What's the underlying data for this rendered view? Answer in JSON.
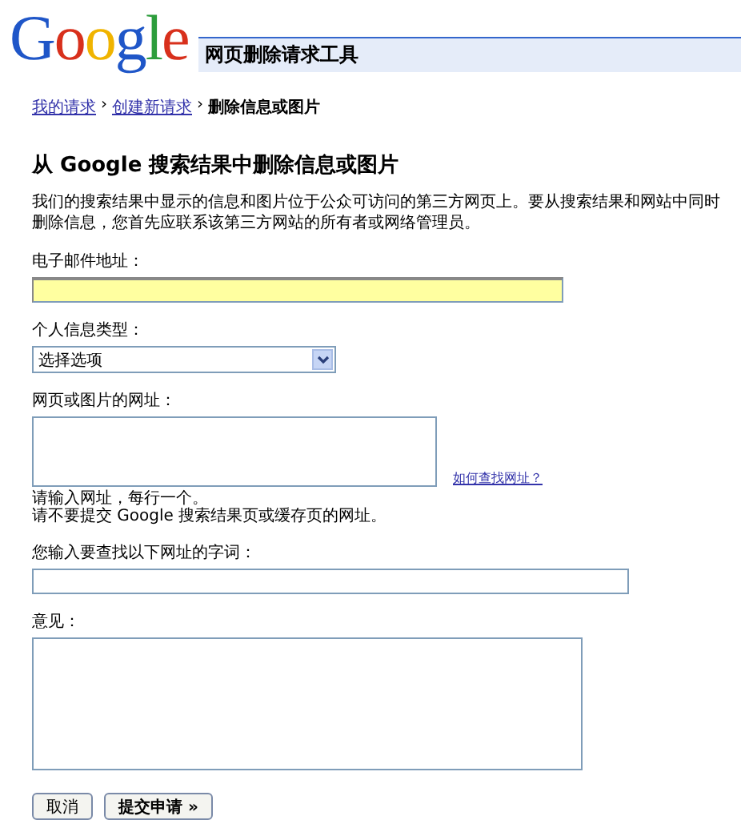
{
  "header": {
    "logo": "Google",
    "title": "网页删除请求工具"
  },
  "breadcrumb": [
    {
      "label": "我的请求",
      "kind": "link"
    },
    {
      "label": "›",
      "kind": "sep"
    },
    {
      "label": "创建新请求",
      "kind": "link"
    },
    {
      "label": "›",
      "kind": "sep"
    },
    {
      "label": "删除信息或图片",
      "kind": "current"
    }
  ],
  "heading": "从 Google 搜索结果中删除信息或图片",
  "intro": "我们的搜索结果中显示的信息和图片位于公众可访问的第三方网页上。要从搜索结果和网站中同时删除信息，您首先应联系该第三方网站的所有者或网络管理员。",
  "fields": [
    {
      "kind": "text",
      "label": "电子邮件地址：",
      "highlighted": true
    },
    {
      "kind": "select",
      "label": "个人信息类型：",
      "value": "选择选项"
    },
    {
      "kind": "textarea",
      "label": "网页或图片的网址：",
      "link": "如何查找网址？",
      "hints": [
        "请输入网址，每行一个。",
        "请不要提交 Google 搜索结果页或缓存页的网址。"
      ]
    },
    {
      "kind": "text",
      "label": "您输入要查找以下网址的字词：",
      "highlighted": false
    },
    {
      "kind": "textarea",
      "label": "意见："
    }
  ],
  "buttons": [
    {
      "label": "取消",
      "primary": false
    },
    {
      "label": "提交申请 »",
      "primary": true
    }
  ]
}
